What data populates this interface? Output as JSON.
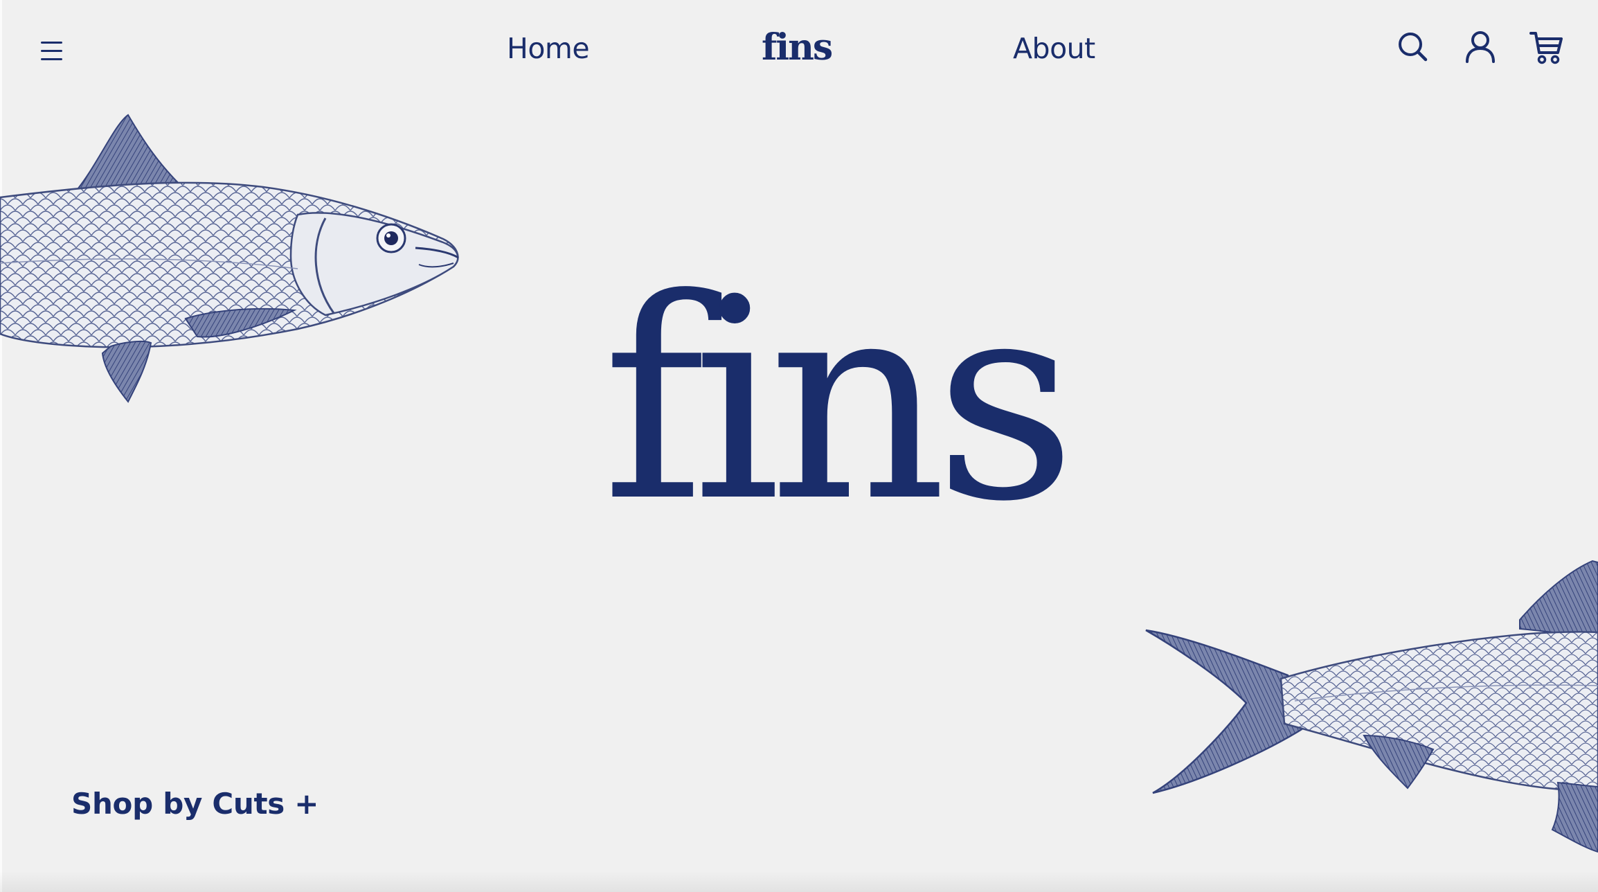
{
  "header": {
    "menu_icon": "hamburger-menu-icon",
    "nav_home": "Home",
    "brand": "fins",
    "nav_about": "About",
    "icons": [
      "search-icon",
      "account-icon",
      "cart-icon"
    ]
  },
  "hero": {
    "logo": "fins",
    "images": [
      "herring-fish-head-illustration",
      "herring-fish-tail-illustration"
    ]
  },
  "footer": {
    "shop_by_cuts": "Shop by Cuts +"
  },
  "colors": {
    "background": "#f0f0f0",
    "brand_navy": "#1a2d6b",
    "fish_engraving": "#4e5c8e"
  }
}
